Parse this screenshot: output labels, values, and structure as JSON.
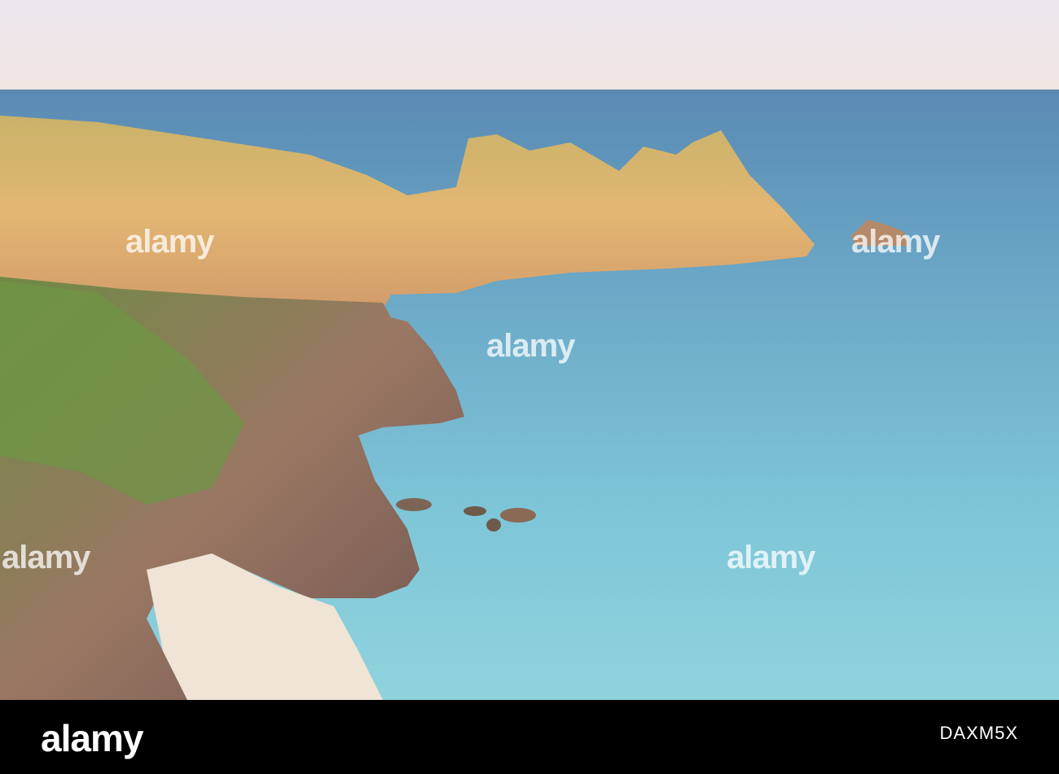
{
  "photo": {
    "subject": "coastal cliffs",
    "colors": {
      "sky": "#ece6ec",
      "sea_far": "#5b8db5",
      "sea_near": "#86cdd9",
      "cliff_sun": "#e0b470",
      "cliff_shade": "#8a6a5a",
      "grass": "#6f8f40",
      "sand": "#f0e6d8"
    }
  },
  "watermark": {
    "text": "alamy"
  },
  "footer": {
    "logo": "alamy",
    "image_id": "DAXM5X"
  }
}
